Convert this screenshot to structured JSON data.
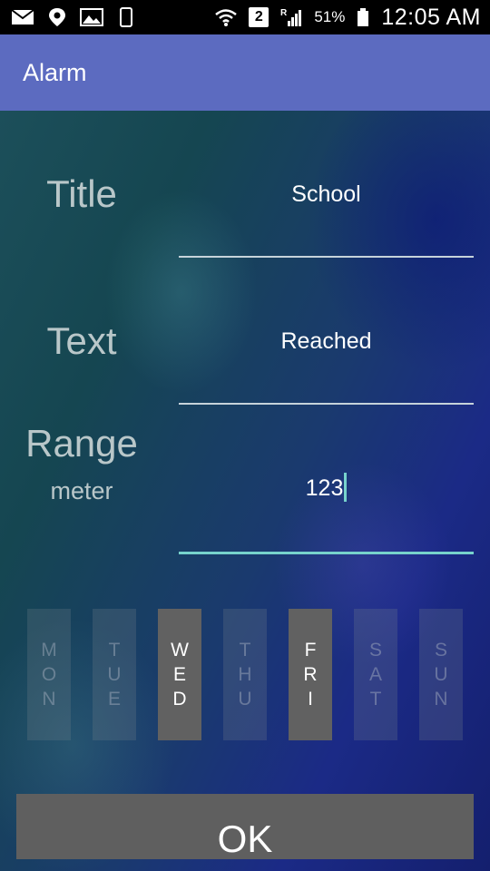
{
  "status_bar": {
    "icons_left": [
      "mail-icon",
      "location-pin-icon",
      "image-icon",
      "phone-icon"
    ],
    "icons_right": [
      "wifi-icon",
      "sim2-badge-icon",
      "roaming-signal-icon",
      "battery-icon"
    ],
    "sim_badge": "2",
    "roaming": "R",
    "battery_percent": "51%",
    "time": "12:05 AM"
  },
  "app_bar": {
    "title": "Alarm"
  },
  "form": {
    "title_label": "Title",
    "title_value": "School",
    "text_label": "Text",
    "text_value": "Reached",
    "range_label": "Range",
    "range_unit": "meter",
    "range_value": "123"
  },
  "days": [
    {
      "label": [
        "M",
        "O",
        "N"
      ],
      "selected": false
    },
    {
      "label": [
        "T",
        "U",
        "E"
      ],
      "selected": false
    },
    {
      "label": [
        "W",
        "E",
        "D"
      ],
      "selected": true
    },
    {
      "label": [
        "T",
        "H",
        "U"
      ],
      "selected": false
    },
    {
      "label": [
        "F",
        "R",
        "I"
      ],
      "selected": true
    },
    {
      "label": [
        "S",
        "A",
        "T"
      ],
      "selected": false
    },
    {
      "label": [
        "S",
        "U",
        "N"
      ],
      "selected": false
    }
  ],
  "ok_button": {
    "label": "OK"
  },
  "colors": {
    "app_bar": "#5c6bc0",
    "accent": "#77d3cc",
    "day_selected": "#616161",
    "ok_button": "#5f5f5f"
  }
}
